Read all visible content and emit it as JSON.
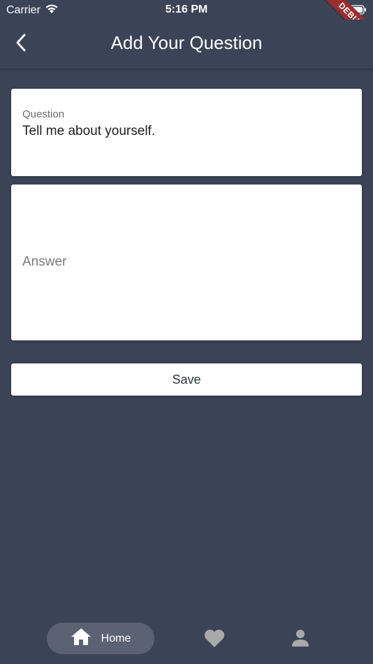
{
  "status_bar": {
    "carrier": "Carrier",
    "time": "5:16 PM"
  },
  "debug_banner": {
    "label": "DEBUG",
    "color": "#9c2e2e"
  },
  "header": {
    "title": "Add Your Question",
    "back_icon": "chevron-left-icon"
  },
  "form": {
    "question": {
      "label": "Question",
      "value": "Tell me about yourself."
    },
    "answer": {
      "placeholder": "Answer",
      "value": ""
    },
    "save_label": "Save"
  },
  "bottom_nav": {
    "items": [
      {
        "label": "Home",
        "icon": "home-icon",
        "active": true
      },
      {
        "label": "",
        "icon": "heart-icon",
        "active": false
      },
      {
        "label": "",
        "icon": "person-icon",
        "active": false
      }
    ]
  },
  "colors": {
    "background": "#3b4357",
    "card": "#ffffff",
    "active_pill": "#5b6274",
    "inactive_icon": "#a9a9a9"
  }
}
